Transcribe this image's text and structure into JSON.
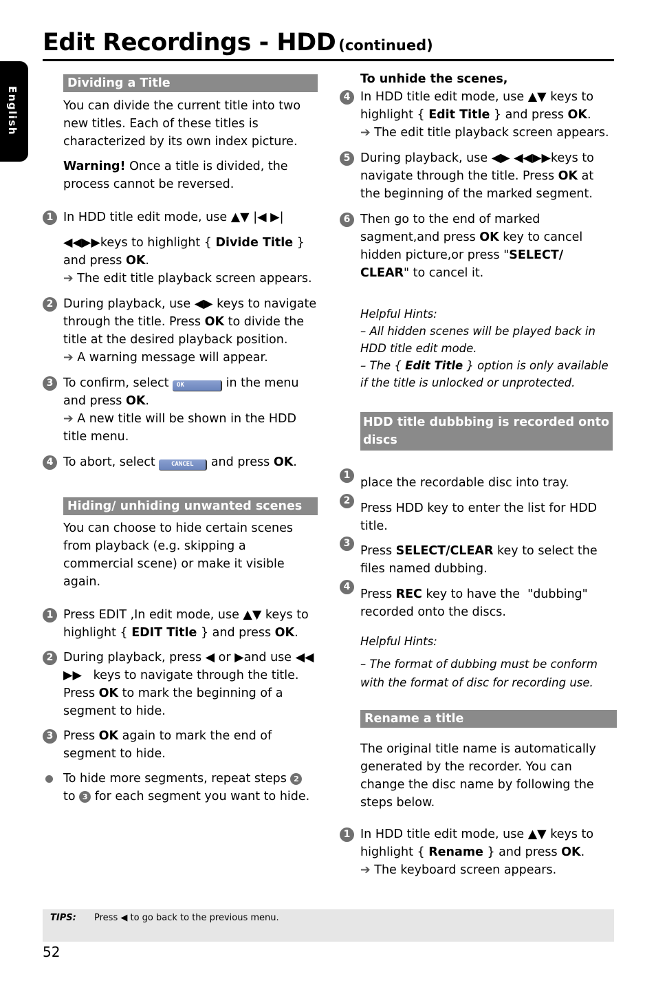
{
  "header": {
    "title": "Edit Recordings - HDD",
    "subtitle": "(continued)"
  },
  "language_tab": "English",
  "left": {
    "dividing": {
      "heading": "Dividing a Title",
      "intro": "You can divide the current title into two new titles. Each of these titles is characterized by its own index picture.",
      "warning_label": "Warning!",
      "warning_text": " Once a title is divided, the process cannot be reversed.",
      "step1": {
        "num": "1",
        "line1": "In HDD title edit mode, use ▲▼ |◀  ▶|",
        "line2_a": "◀◀▶▶keys to highlight { ",
        "line2_b": "Divide Title",
        "line2_c": " } and press ",
        "ok": "OK",
        "result": "The edit title playback screen appears."
      },
      "step2": {
        "num": "2",
        "text_a": "During playback, use ◀▶ keys to navigate through the title. Press ",
        "ok": "OK",
        "text_b": " to divide the title at the desired playback position.",
        "result": "A warning message will appear."
      },
      "step3": {
        "num": "3",
        "text_a": "To confirm, select ",
        "button": "OK",
        "text_b": " in the menu and press ",
        "ok": "OK",
        "result": "A new title will be shown in the HDD title menu."
      },
      "step4": {
        "num": "4",
        "text_a": "To abort, select ",
        "button": "CANCEL",
        "text_b": " and press ",
        "ok": "OK"
      }
    },
    "hiding": {
      "heading": "Hiding/ unhiding unwanted scenes",
      "intro": "You can choose to hide certain scenes from playback (e.g. skipping a commercial scene) or make it visible again.",
      "step1": {
        "num": "1",
        "text_a": "Press EDIT ,In edit mode, use ▲▼ keys to highlight { ",
        "bold": "EDIT Title",
        "text_b": " } and press ",
        "ok": "OK"
      },
      "step2": {
        "num": "2",
        "text_a": "During playback, press ◀ or ▶and use ◀◀   ▶▶   keys to navigate through the title. Press ",
        "ok": "OK",
        "text_b": " to mark the beginning of a segment to hide."
      },
      "step3": {
        "num": "3",
        "text_a": "Press ",
        "ok": "OK",
        "text_b": " again to mark the end of segment to hide."
      },
      "bullet": {
        "text_a": "To hide more segments, repeat steps ",
        "ref1": "2",
        "text_b": " to ",
        "ref2": "3",
        "text_c": " for each segment you want to hide."
      }
    }
  },
  "right": {
    "unhide": {
      "heading": "To unhide the scenes,",
      "step4": {
        "num": "4",
        "text_a": "In HDD title edit mode, use ▲▼ keys to highlight { ",
        "bold": "Edit Title",
        "text_b": " } and press ",
        "ok": "OK",
        "result": "The edit title playback screen appears."
      },
      "step5": {
        "num": "5",
        "text_a": "During playback, use ◀▶ ◀◀▶▶keys to navigate through the title. Press ",
        "ok": "OK",
        "text_b": " at the beginning of the marked segment."
      },
      "step6": {
        "num": "6",
        "text_a": "Then go to the end of marked sagment,and press ",
        "ok": "OK",
        "text_b": " key to cancel hidden picture,or press \"",
        "bold": "SELECT/ CLEAR",
        "text_c": "\" to cancel it."
      },
      "hints": {
        "title": "Helpful Hints:",
        "hint1": "–  All hidden scenes will be played back in HDD title edit mode.",
        "hint2_a": "–  The { ",
        "hint2_b": "Edit Title",
        "hint2_c": " } option is only available if the title is unlocked or unprotected."
      }
    },
    "dubbing": {
      "heading": "HDD title dubbbing is recorded onto discs",
      "step1": {
        "num": "1",
        "text": "place the recordable disc into tray."
      },
      "step2": {
        "num": "2",
        "text": "Press HDD key to enter the list for HDD title."
      },
      "step3": {
        "num": "3",
        "text_a": "Press ",
        "bold": "SELECT/CLEAR",
        "text_b": " key to select the files named dubbing."
      },
      "step4": {
        "num": "4",
        "text_a": "Press ",
        "bold": "REC",
        "text_b": " key to have the  \"dubbing\" recorded onto the discs."
      },
      "hints": {
        "title": "Helpful Hints:",
        "hint1": "–  The format of dubbing must be conform with the format of disc for recording use."
      }
    },
    "rename": {
      "heading": "Rename a title",
      "intro": "The original title name is automatically generated by the recorder. You can change the disc name by following the steps below.",
      "step1": {
        "num": "1",
        "text_a": "In HDD title edit mode, use ▲▼ keys to highlight { ",
        "bold": "Rename",
        "text_b": " } and press ",
        "ok": "OK",
        "result": "The keyboard screen appears."
      }
    }
  },
  "footer": {
    "tips_label": "TIPS:",
    "tips_text": "Press ◀ to go back to the previous menu.",
    "page_number": "52"
  },
  "icons": {
    "arrow": "➔"
  }
}
